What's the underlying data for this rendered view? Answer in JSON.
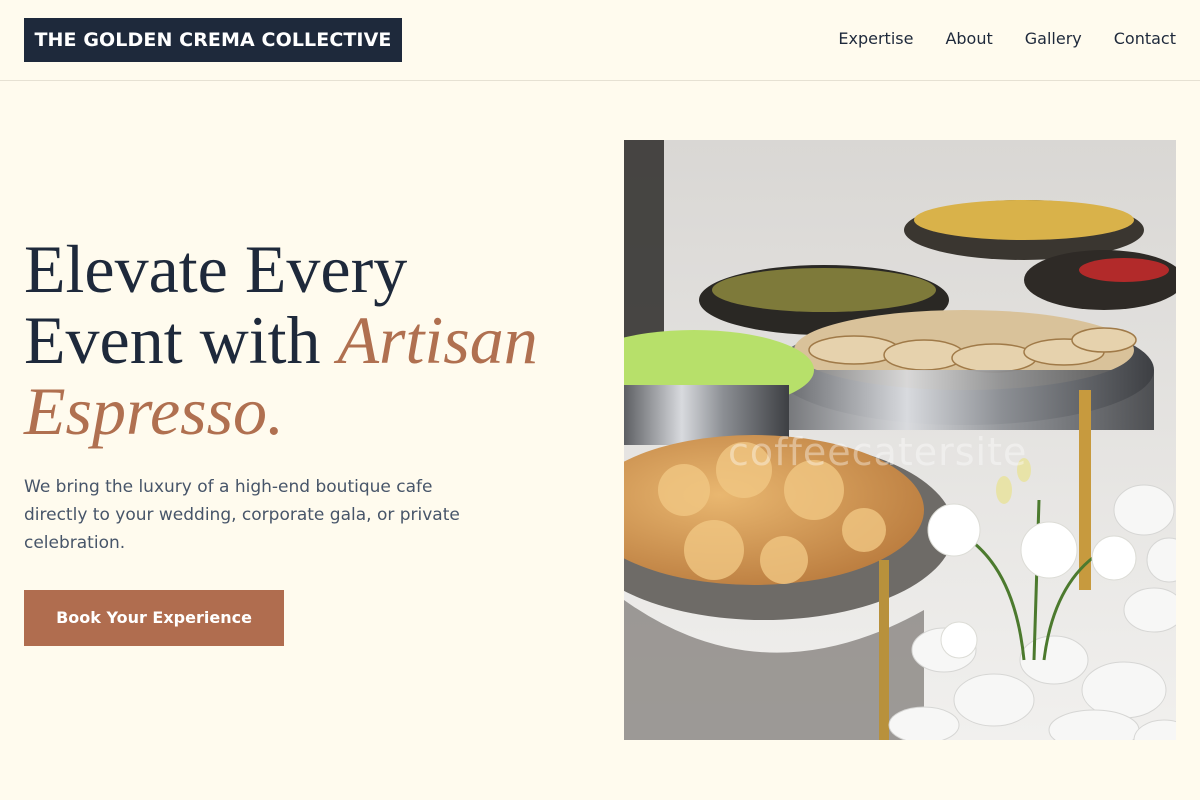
{
  "header": {
    "logo_text": "THE GOLDEN CREMA COLLECTIVE",
    "nav": [
      {
        "label": "Expertise"
      },
      {
        "label": "About"
      },
      {
        "label": "Gallery"
      },
      {
        "label": "Contact"
      }
    ]
  },
  "hero": {
    "title_line1": "Elevate Every",
    "title_line2": "Event with ",
    "title_accent": "Artisan Espresso.",
    "subtitle": "We bring the luxury of a high-end boutique cafe directly to your wedding, corporate gala, or private celebration.",
    "cta_label": "Book Your Experience",
    "image_watermark": "coffeecatersite"
  },
  "colors": {
    "background": "#fffbee",
    "navy": "#1e293b",
    "accent": "#b06d4f"
  }
}
